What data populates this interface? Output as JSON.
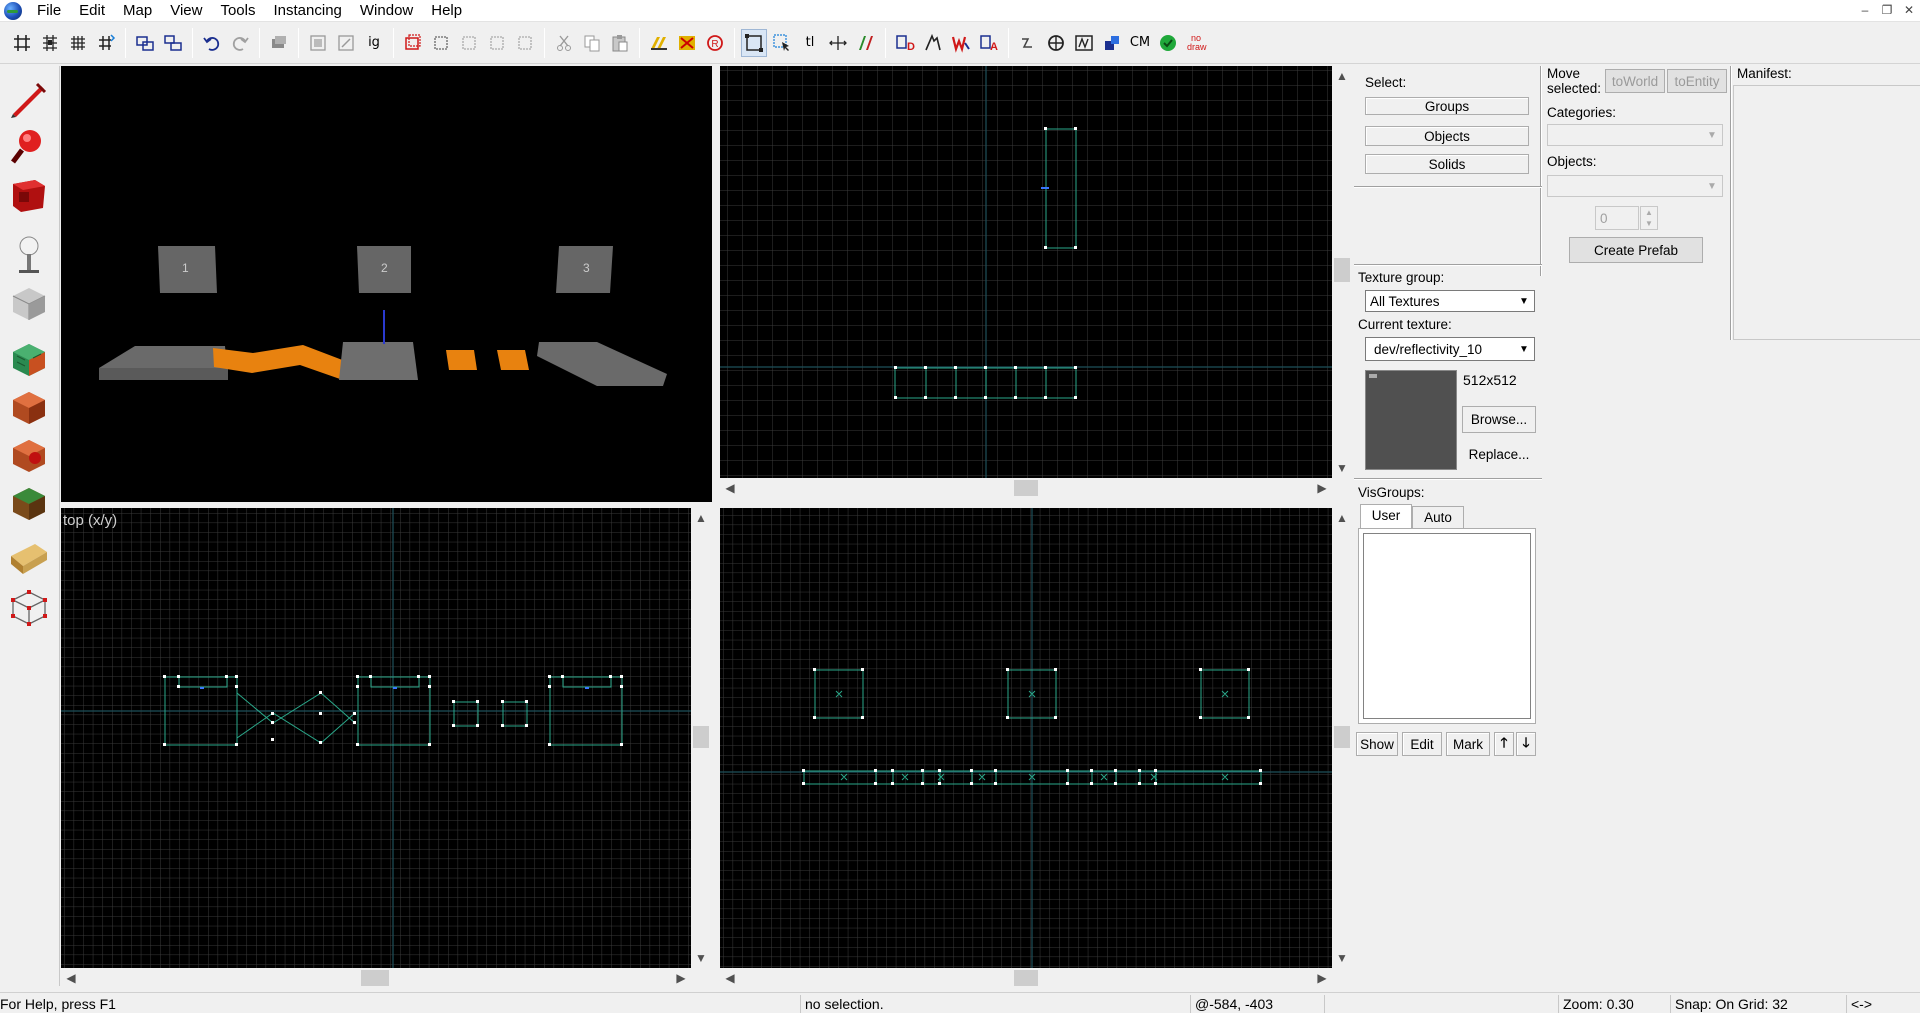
{
  "menu": [
    "File",
    "Edit",
    "Map",
    "View",
    "Tools",
    "Instancing",
    "Window",
    "Help"
  ],
  "window_controls": [
    "–",
    "❐",
    "✕"
  ],
  "toolbar": {
    "text_buttons": {
      "cm": "CM",
      "nodraw": "no draw",
      "tl": "tl",
      "ig": "ig"
    }
  },
  "viewports": {
    "camera_labels": [
      "1",
      "2",
      "3"
    ],
    "top_label": "top (x/y)"
  },
  "select_panel": {
    "label": "Select:",
    "groups": "Groups",
    "objects": "Objects",
    "solids": "Solids"
  },
  "move_panel": {
    "label": "Move selected:",
    "to_world": "toWorld",
    "to_entity": "toEntity",
    "categories_label": "Categories:",
    "objects_label": "Objects:",
    "spin_value": "0",
    "create_prefab": "Create Prefab"
  },
  "manifest": {
    "label": "Manifest:"
  },
  "texture_panel": {
    "group_label": "Texture group:",
    "group_value": "All Textures",
    "current_label": "Current texture:",
    "current_value": "dev/reflectivity_10",
    "size": "512x512",
    "browse": "Browse...",
    "replace": "Replace..."
  },
  "visgroups": {
    "label": "VisGroups:",
    "tabs": [
      "User",
      "Auto"
    ],
    "show": "Show",
    "edit": "Edit",
    "mark": "Mark"
  },
  "status": {
    "help": "For Help, press F1",
    "selection": "no selection.",
    "coords": "@-584, -403",
    "zoom": "Zoom: 0.30",
    "snap": "Snap: On Grid: 32",
    "extra": "<->"
  }
}
